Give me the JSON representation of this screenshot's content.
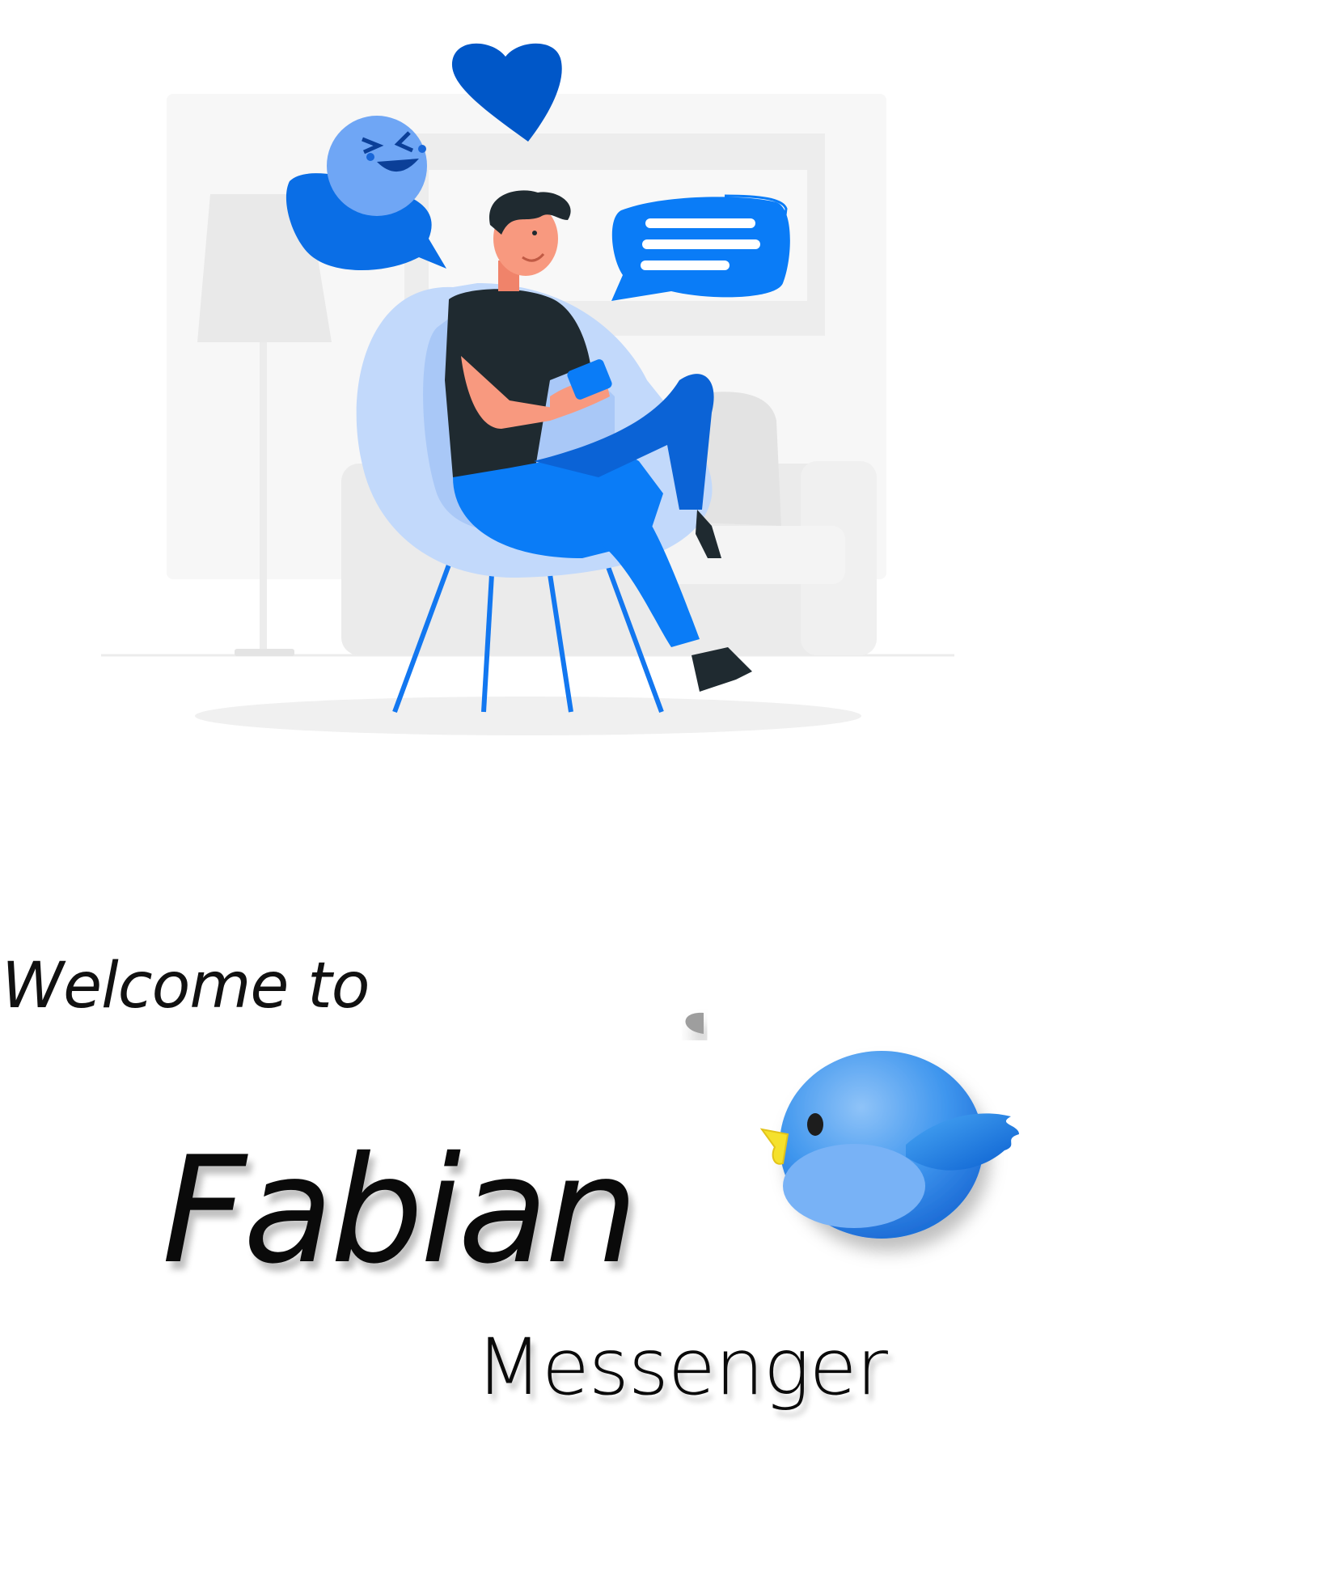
{
  "welcome": {
    "intro": "Welcome to",
    "brand_name": "Fabian",
    "product": "Messenger"
  },
  "illustration": {
    "icons": [
      "heart-icon",
      "laughing-emoji-icon",
      "chat-bubble-icon",
      "bird-logo-icon"
    ]
  },
  "colors": {
    "accent_blue": "#0a7cf7",
    "dark_blue": "#0057c8",
    "light_blue": "#bfd7fb",
    "bird_blue": "#4aa1f0",
    "text": "#0a0a0a"
  }
}
